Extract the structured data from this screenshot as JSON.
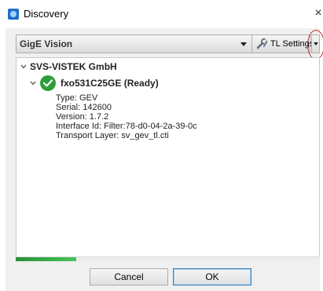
{
  "window": {
    "title": "Discovery",
    "close_glyph": "×",
    "icon": "discovery-app-icon"
  },
  "toolbar": {
    "interface_selected": "GigE Vision",
    "tl_settings_label": "TL Settings",
    "tl_settings_icon": "wrench-icon"
  },
  "tree": {
    "root_label": "SVS-VISTEK GmbH",
    "device": {
      "name": "fxo531C25GE (Ready)",
      "status_icon": "check-icon",
      "status_color": "#2e9d3a",
      "details": [
        "Type: GEV",
        "Serial: 142600",
        "Version: 1.7.2",
        "Interface Id: Filter:78-d0-04-2a-39-0c",
        "Transport Layer: sv_gev_tl.cti"
      ]
    }
  },
  "progress": {
    "fraction": 0.2
  },
  "buttons": {
    "cancel_label": "Cancel",
    "ok_label": "OK"
  },
  "colors": {
    "highlight_circle": "#c0282b",
    "progress": "#2b8e3a"
  }
}
